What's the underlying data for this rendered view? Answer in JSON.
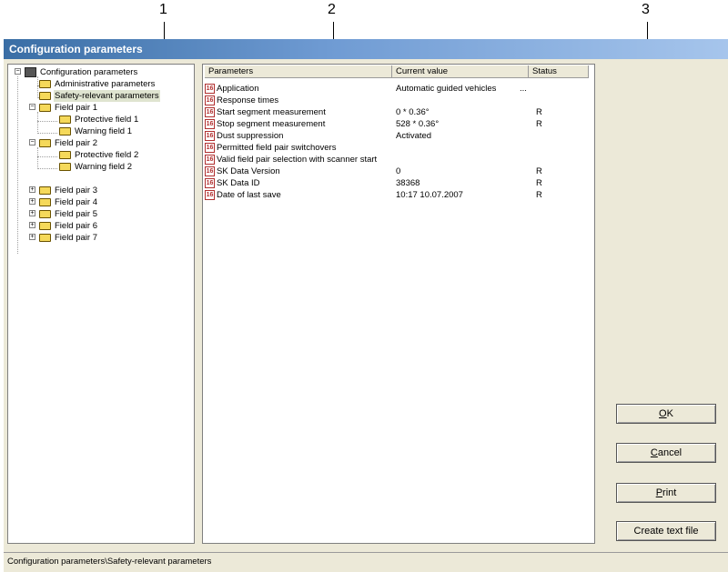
{
  "callouts": [
    "1",
    "2",
    "3"
  ],
  "window": {
    "title": "Configuration parameters"
  },
  "tree": {
    "items": [
      {
        "label": "Configuration parameters"
      },
      {
        "label": "Administrative parameters"
      },
      {
        "label": "Safety-relevant parameters",
        "selected": true
      },
      {
        "label": "Field pair 1"
      },
      {
        "label": "Protective field 1"
      },
      {
        "label": "Warning field 1"
      },
      {
        "label": "Field pair 2"
      },
      {
        "label": "Protective field 2"
      },
      {
        "label": "Warning field 2"
      },
      {
        "label": "Field pair 3"
      },
      {
        "label": "Field pair 4"
      },
      {
        "label": "Field pair 5"
      },
      {
        "label": "Field pair 6"
      },
      {
        "label": "Field pair 7"
      }
    ],
    "expanders": [
      "−",
      "−",
      "−",
      "+",
      "+",
      "+",
      "+",
      "+"
    ]
  },
  "list": {
    "columns": [
      "Parameters",
      "Current value",
      "Status"
    ],
    "icon_text": "16",
    "rows": [
      {
        "param": "Application",
        "value": "Automatic guided vehicles",
        "extra": "...",
        "status": ""
      },
      {
        "param": "Response times",
        "value": "",
        "extra": "",
        "status": ""
      },
      {
        "param": "Start segment measurement",
        "value": "0 * 0.36°",
        "extra": "",
        "status": "R"
      },
      {
        "param": "Stop segment measurement",
        "value": "528 * 0.36°",
        "extra": "",
        "status": "R"
      },
      {
        "param": "Dust suppression",
        "value": "Activated",
        "extra": "",
        "status": ""
      },
      {
        "param": "Permitted field pair switchovers",
        "value": "",
        "extra": "",
        "status": ""
      },
      {
        "param": "Valid field pair selection with scanner start",
        "value": "",
        "extra": "",
        "status": ""
      },
      {
        "param": "SK Data Version",
        "value": "0",
        "extra": "",
        "status": "R"
      },
      {
        "param": "SK Data ID",
        "value": "38368",
        "extra": "",
        "status": "R"
      },
      {
        "param": "Date of last save",
        "value": "10:17 10.07.2007",
        "extra": "",
        "status": "R"
      }
    ]
  },
  "buttons": {
    "ok": {
      "key": "O",
      "rest": "K"
    },
    "cancel": {
      "key": "C",
      "rest": "ancel"
    },
    "print": {
      "key": "P",
      "rest": "rint"
    },
    "create_text_file": "Create text file"
  },
  "status_bar": {
    "text": "Configuration parameters\\Safety-relevant parameters"
  }
}
